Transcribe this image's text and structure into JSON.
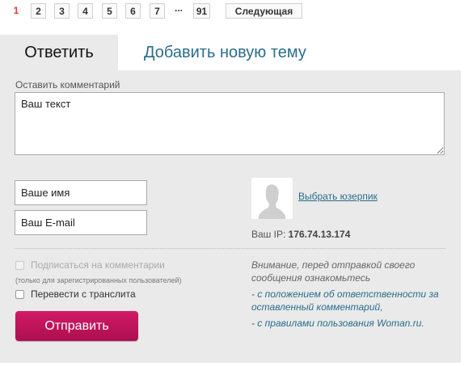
{
  "pagination": {
    "pages": [
      "1",
      "2",
      "3",
      "4",
      "5",
      "6",
      "7"
    ],
    "ellipsis": "...",
    "last": "91",
    "next_label": "Следующая"
  },
  "tabs": {
    "reply": "Ответить",
    "new_topic": "Добавить новую тему"
  },
  "form": {
    "comment_label": "Оставить комментарий",
    "comment_value": "Ваш текст",
    "name_value": "Ваше имя",
    "email_value": "Ваш E-mail",
    "choose_userpic": "Выбрать юзерпик",
    "ip_label": "Ваш IP:",
    "ip_value": "176.74.13.174",
    "subscribe_label": "Подписаться на комментарии",
    "subscribe_note": "(только для зарегистрированных пользователей)",
    "translit_label": "Перевести с транслита",
    "submit_label": "Отправить"
  },
  "notice": {
    "line1": "Внимание, перед отправкой своего",
    "line2": "сообщения ознакомьтесь",
    "link1_line1": "- с положением об ответственности за",
    "link1_line2": "оставленный комментарий,",
    "link2": "- с правилами пользования Woman.ru."
  },
  "colors": {
    "accent": "#c8155d",
    "link": "#2a6d8c",
    "current_page": "#e03a3a",
    "panel_bg": "#eaeaea"
  }
}
